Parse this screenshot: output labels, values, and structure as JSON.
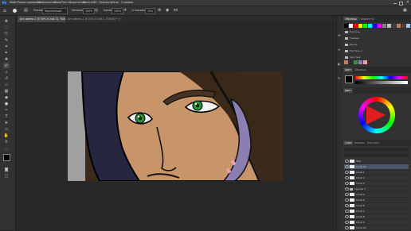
{
  "menubar": {
    "logo": "Ps",
    "items": [
      "Файл",
      "Редактирование",
      "Изображение",
      "Слои",
      "Текст",
      "Выделение",
      "Фильтр",
      "3D",
      "Просмотр",
      "Окно",
      "Справка"
    ]
  },
  "optbar": {
    "mode_label": "Режим:",
    "mode_value": "Нормальный",
    "opacity_label": "Непрозр.:",
    "opacity_value": "100%",
    "flow_label": "Нажим:",
    "flow_value": "100%",
    "smooth_label": "Сглаживание:",
    "smooth_value": "10%"
  },
  "document_tabs": [
    {
      "label": "Без имени-1 @ 50% (Слой 32, RGB/8) *",
      "active": true
    },
    {
      "label": "Без имени-1 @ 50% (Слой 1, RGB/8) *",
      "active": false
    }
  ],
  "panels": {
    "swatches_tabs": [
      "Образцы",
      "Градиенты"
    ],
    "swatch_colors": [
      "#000000",
      "#ffffff",
      "#ff0000",
      "#ffff00",
      "#00ff00",
      "#00ffff",
      "#0000ff",
      "#ff00ff",
      "#7f7f7f",
      "#bfbfbf",
      "#3f3f3f",
      "#c08060",
      "#5a3a2a",
      "#a0c8ff",
      "#ffd0a0"
    ],
    "presets": [
      "Пастель",
      "Темные",
      "Яркие",
      "Пастель 2",
      "Светлые"
    ],
    "color_tabs": [
      "Цвет",
      "Образцы"
    ],
    "wheel_tabs": [
      "Цвет"
    ],
    "layers_tabs": [
      "Слои",
      "Каналы",
      "Контуры"
    ],
    "layers": [
      "Фон",
      "Слой 32",
      "Слой 1",
      "Слой 2",
      "Слой 3",
      "Группа 1",
      "Слой 4",
      "Слой 5",
      "Слой 6",
      "Слой 7",
      "Слой 8",
      "Слой 9",
      "Слой 10"
    ]
  }
}
